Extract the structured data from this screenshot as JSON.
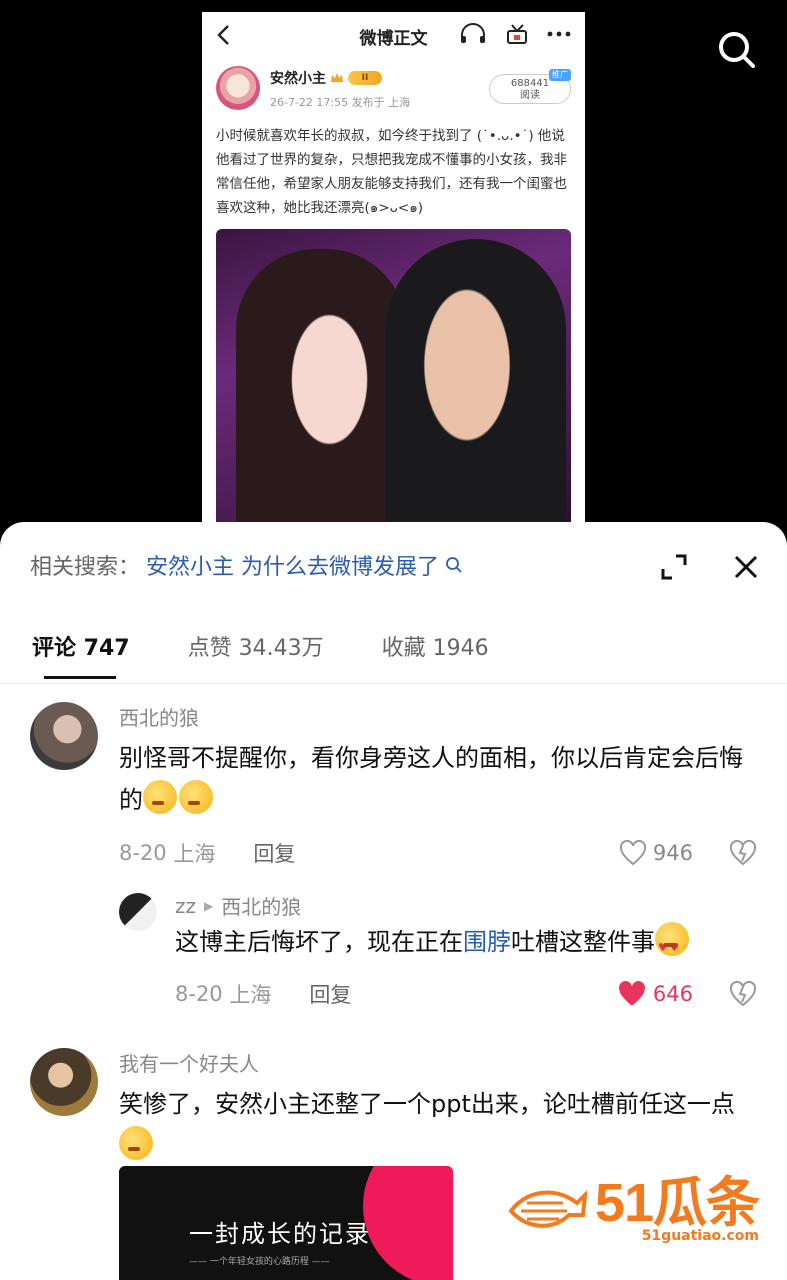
{
  "weibo": {
    "nav_title": "微博正文",
    "author_name": "安然小主",
    "vip_badge": "II",
    "meta": "26-7-22 17:55  发布于 上海",
    "read_count": "688441",
    "read_label": "阅读",
    "ad_badge": "推广",
    "post_text": "小时候就喜欢年长的叔叔，如今终于找到了 (˙•.ᴗ.•˙) 他说他看过了世界的复杂，只想把我宠成不懂事的小女孩，我非常信任他，希望家人朋友能够支持我们，还有我一个闺蜜也喜欢这种，她比我还漂亮(๑>ᴗ<๑)"
  },
  "related_search": {
    "label": "相关搜索：",
    "query": "安然小主 为什么去微博发展了"
  },
  "tabs": [
    {
      "label": "评论 747"
    },
    {
      "label": "点赞 34.43万"
    },
    {
      "label": "收藏 1946"
    }
  ],
  "comments": [
    {
      "author": "西北的狼",
      "text": "别怪哥不提醒你，看你身旁这人的面相，你以后肯定会后悔的",
      "date": "8-20",
      "location": "上海",
      "reply_label": "回复",
      "likes": "946",
      "replies": [
        {
          "author": "zz",
          "reply_to": "西北的狼",
          "text_before": "这博主后悔坏了，现在正在",
          "link": "围脖",
          "text_after": "吐槽这整件事",
          "date": "8-20",
          "location": "上海",
          "reply_label": "回复",
          "likes": "646"
        }
      ]
    },
    {
      "author": "我有一个好夫人",
      "text": "笑惨了，安然小主还整了一个ppt出来，论吐槽前任这一点"
    }
  ],
  "thumbnail": {
    "title": "一封成长的记录",
    "subtitle": "—— 一个年轻女孩的心路历程 ——"
  },
  "watermark": {
    "brand": "51瓜条",
    "url": "51guatiao.com",
    "color": "#f47a1e"
  }
}
